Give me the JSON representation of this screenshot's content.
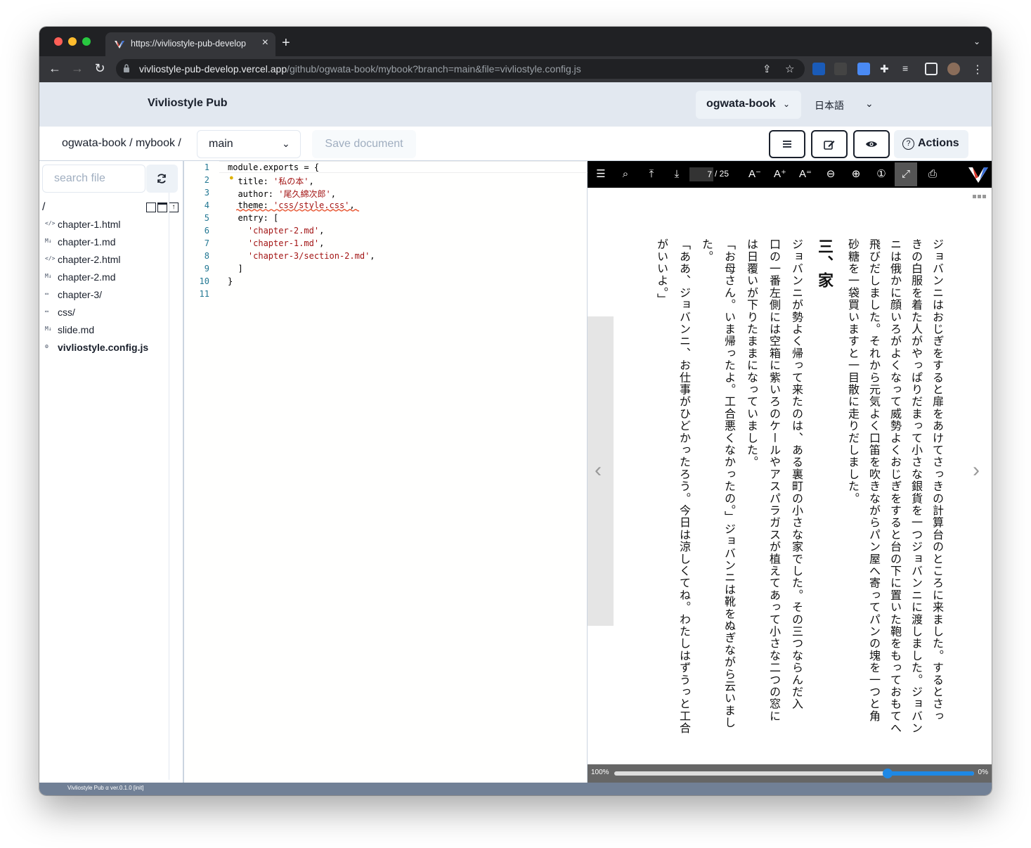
{
  "browser": {
    "tab_title": "https://vivliostyle-pub-develop",
    "url_host": "vivliostyle-pub-develop.vercel.app",
    "url_path": "/github/ogwata-book/mybook?branch=main&file=vivliostyle.config.js"
  },
  "header": {
    "brand": "Vivliostyle Pub",
    "user": "ogwata-book",
    "language": "日本語"
  },
  "toolbar": {
    "breadcrumb": "ogwata-book / mybook /",
    "branch": "main",
    "save_label": "Save document",
    "actions_label": "Actions"
  },
  "sidebar": {
    "search_placeholder": "search file",
    "root": "/",
    "files": [
      {
        "icon": "</>",
        "icon_name": "html-file-icon",
        "name": "chapter-1.html",
        "bold": false
      },
      {
        "icon": "M↓",
        "icon_name": "markdown-file-icon",
        "name": "chapter-1.md",
        "bold": false
      },
      {
        "icon": "</>",
        "icon_name": "html-file-icon",
        "name": "chapter-2.html",
        "bold": false
      },
      {
        "icon": "M↓",
        "icon_name": "markdown-file-icon",
        "name": "chapter-2.md",
        "bold": false
      },
      {
        "icon": "▭",
        "icon_name": "folder-icon",
        "name": "chapter-3/",
        "bold": false
      },
      {
        "icon": "▭",
        "icon_name": "folder-icon",
        "name": "css/",
        "bold": false
      },
      {
        "icon": "M↓",
        "icon_name": "markdown-file-icon",
        "name": "slide.md",
        "bold": false
      },
      {
        "icon": "⚙",
        "icon_name": "gear-icon",
        "name": "vivliostyle.config.js",
        "bold": true
      }
    ]
  },
  "editor": {
    "line_numbers": [
      "1",
      "2",
      "3",
      "4",
      "5",
      "6",
      "7",
      "8",
      "9",
      "10",
      "11"
    ],
    "lines": [
      [
        {
          "t": "module.exports = {",
          "s": false
        }
      ],
      [
        {
          "t": "  title: ",
          "s": false
        },
        {
          "t": "'私の本'",
          "s": true
        },
        {
          "t": ",",
          "s": false
        }
      ],
      [
        {
          "t": "  author: ",
          "s": false
        },
        {
          "t": "'尾久綿次郎'",
          "s": true
        },
        {
          "t": ",",
          "s": false
        }
      ],
      [
        {
          "t": "  theme: ",
          "s": false
        },
        {
          "t": "'css/style.css'",
          "s": true
        },
        {
          "t": ",",
          "s": false
        }
      ],
      [
        {
          "t": "  entry: [",
          "s": false
        }
      ],
      [
        {
          "t": "    ",
          "s": false
        },
        {
          "t": "'chapter-2.md'",
          "s": true
        },
        {
          "t": ",",
          "s": false
        }
      ],
      [
        {
          "t": "    ",
          "s": false
        },
        {
          "t": "'chapter-1.md'",
          "s": true
        },
        {
          "t": ",",
          "s": false
        }
      ],
      [
        {
          "t": "    ",
          "s": false
        },
        {
          "t": "'chapter-3/section-2.md'",
          "s": true
        },
        {
          "t": ",",
          "s": false
        }
      ],
      [
        {
          "t": "  ]",
          "s": false
        }
      ],
      [
        {
          "t": "}",
          "s": false
        }
      ],
      [
        {
          "t": "",
          "s": false
        }
      ]
    ]
  },
  "viewer": {
    "current_page": "7",
    "total_pages": "/ 25",
    "zoom_left": "100%",
    "zoom_right": "0%",
    "progress_fraction": 0.76,
    "columns": [
      "ジョバンニはおじぎをすると扉をあけてさっきの計算台のところに来ました。するとさっ",
      "きの白服を着た人がやっぱりだまって小さな銀貨を一つジョバンニに渡しました。ジョバン",
      "ニは俄かに顔いろがよくなって威勢よくおじぎをすると台の下に置いた鞄をもっておもてへ",
      "飛びだしました。それから元気よく口笛を吹きながらパン屋へ寄ってパンの塊を一つと角",
      "砂糖を一袋買いますと一目散に走りだしました。"
    ],
    "heading": "三、家",
    "columns2": [
      "ジョバンニが勢よく帰って来たのは、ある裏町の小さな家でした。その三つならんだ入",
      "口の一番左側には空箱に紫いろのケールやアスパラガスが植えてあって小さな二つの窓に",
      "は日覆いが下りたままになっていました。",
      "「お母さん。いま帰ったよ。工合悪くなかったの。」ジョバンニは靴をぬぎながら云いまし",
      "た。",
      "「ああ、ジョバンニ、お仕事がひどかったろう。今日は涼しくてね。わたしはずうっと工合",
      "がいいよ。」"
    ]
  },
  "footer": {
    "version": "Vivliostyle Pub α ver.0.1.0 [init]"
  }
}
